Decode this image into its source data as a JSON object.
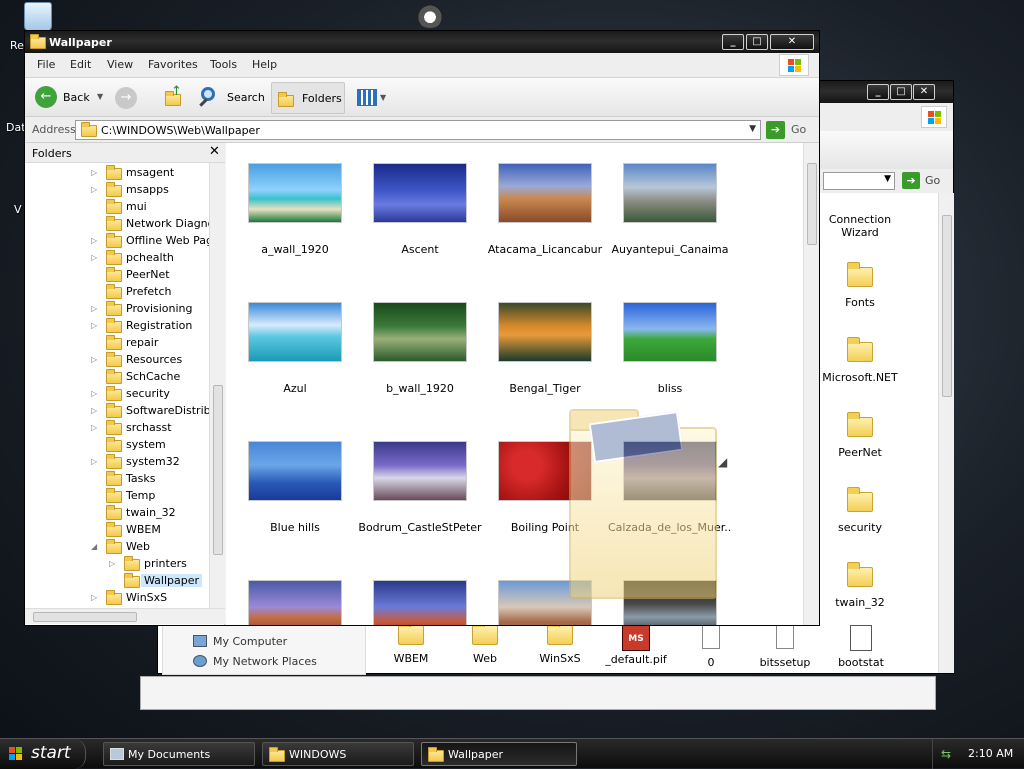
{
  "desktop": {
    "partial_labels": [
      "Re",
      "Dat",
      "V"
    ]
  },
  "back_window": {
    "go_label": "Go",
    "places": [
      "My Computer",
      "My Network Places"
    ],
    "folders": [
      "Connection Wizard",
      "Fonts",
      "Microsoft.NET",
      "PeerNet",
      "security",
      "twain_32"
    ],
    "bottom_items": [
      "WBEM",
      "Web",
      "WinSxS",
      "_default.pif",
      "0",
      "bitssetup",
      "bootstat"
    ]
  },
  "window": {
    "title": "Wallpaper",
    "menu": [
      "File",
      "Edit",
      "View",
      "Favorites",
      "Tools",
      "Help"
    ],
    "toolbar": {
      "back_label": "Back",
      "search_label": "Search",
      "folders_label": "Folders"
    },
    "address": {
      "label": "Address",
      "value": "C:\\WINDOWS\\Web\\Wallpaper",
      "go_label": "Go"
    },
    "folders_pane": {
      "title": "Folders",
      "items": [
        {
          "label": "msagent",
          "expander": true
        },
        {
          "label": "msapps",
          "expander": true
        },
        {
          "label": "mui",
          "expander": false
        },
        {
          "label": "Network Diagnostic",
          "expander": false
        },
        {
          "label": "Offline Web Pages",
          "expander": true
        },
        {
          "label": "pchealth",
          "expander": true
        },
        {
          "label": "PeerNet",
          "expander": false
        },
        {
          "label": "Prefetch",
          "expander": false
        },
        {
          "label": "Provisioning",
          "expander": true
        },
        {
          "label": "Registration",
          "expander": true
        },
        {
          "label": "repair",
          "expander": false
        },
        {
          "label": "Resources",
          "expander": true
        },
        {
          "label": "SchCache",
          "expander": false
        },
        {
          "label": "security",
          "expander": true
        },
        {
          "label": "SoftwareDistribution",
          "expander": true
        },
        {
          "label": "srchasst",
          "expander": true
        },
        {
          "label": "system",
          "expander": false
        },
        {
          "label": "system32",
          "expander": true
        },
        {
          "label": "Tasks",
          "expander": false
        },
        {
          "label": "Temp",
          "expander": false
        },
        {
          "label": "twain_32",
          "expander": false
        },
        {
          "label": "WBEM",
          "expander": false
        },
        {
          "label": "Web",
          "expander": true,
          "expanded": true
        },
        {
          "label": "printers",
          "expander": true,
          "child": true
        },
        {
          "label": "Wallpaper",
          "expander": false,
          "child": true,
          "selected": true
        },
        {
          "label": "WinSxS",
          "expander": true
        }
      ]
    },
    "files": [
      {
        "label": "a_wall_1920"
      },
      {
        "label": "Ascent"
      },
      {
        "label": "Atacama_Licancabur"
      },
      {
        "label": "Auyantepui_Canaima"
      },
      {
        "label": "Azul"
      },
      {
        "label": "b_wall_1920"
      },
      {
        "label": "Bengal_Tiger"
      },
      {
        "label": "bliss"
      },
      {
        "label": "Blue hills"
      },
      {
        "label": "Bodrum_CastleStPeter"
      },
      {
        "label": "Boiling Point"
      },
      {
        "label": "Calzada_de_los_Muer..."
      },
      {
        "label": ""
      },
      {
        "label": ""
      },
      {
        "label": ""
      },
      {
        "label": ""
      }
    ]
  },
  "taskbar": {
    "start_label": "start",
    "tasks": [
      {
        "label": "My Documents"
      },
      {
        "label": "WINDOWS"
      },
      {
        "label": "Wallpaper"
      }
    ],
    "clock": "2:10 AM"
  },
  "colors": {
    "selection": "#cce8ff",
    "go_arrow": "#3a9a2a"
  }
}
